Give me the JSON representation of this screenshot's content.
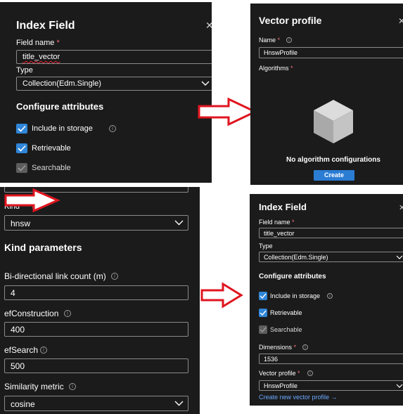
{
  "panel_a": {
    "title": "Index Field",
    "field_name_label": "Field name",
    "required_mark": "*",
    "field_name_value": "title_vector",
    "type_label": "Type",
    "type_value": "Collection(Edm.Single)",
    "configure_heading": "Configure attributes",
    "include_storage_label": "Include in storage",
    "retrievable_label": "Retrievable",
    "searchable_label": "Searchable"
  },
  "panel_b": {
    "title": "Vector profile",
    "name_label": "Name",
    "required_mark": "*",
    "name_value": "HnswProfile",
    "algorithms_label": "Algorithms",
    "empty_text": "No algorithm configurations",
    "create_button": "Create"
  },
  "panel_c": {
    "kind_label": "Kind",
    "kind_value": "hnsw",
    "kind_params_heading": "Kind parameters",
    "m_label": "Bi-directional link count (m)",
    "m_value": "4",
    "efconstruction_label": "efConstruction",
    "efconstruction_value": "400",
    "efsearch_label": "efSearch",
    "efsearch_value": "500",
    "similarity_label": "Similarity metric",
    "similarity_value": "cosine"
  },
  "panel_d": {
    "title": "Index Field",
    "field_name_label": "Field name",
    "required_mark": "*",
    "field_name_value": "title_vector",
    "type_label": "Type",
    "type_value": "Collection(Edm.Single)",
    "configure_heading": "Configure attributes",
    "include_storage_label": "Include in storage",
    "retrievable_label": "Retrievable",
    "searchable_label": "Searchable",
    "dimensions_label": "Dimensions",
    "dimensions_value": "1536",
    "vector_profile_label": "Vector profile",
    "vector_profile_value": "HnswProfile",
    "create_profile_link": "Create new vector profile →"
  },
  "icons": {
    "info": "info-icon",
    "close": "close-icon",
    "chevron": "chevron-down-icon",
    "checkbox": "checkmark-icon",
    "cube": "cube-icon",
    "arrow": "red-arrow-icon"
  },
  "colors": {
    "panel_bg": "#1b1b1b",
    "accent": "#2f86d8",
    "arrow": "#e0151f",
    "required": "#f1707b"
  }
}
